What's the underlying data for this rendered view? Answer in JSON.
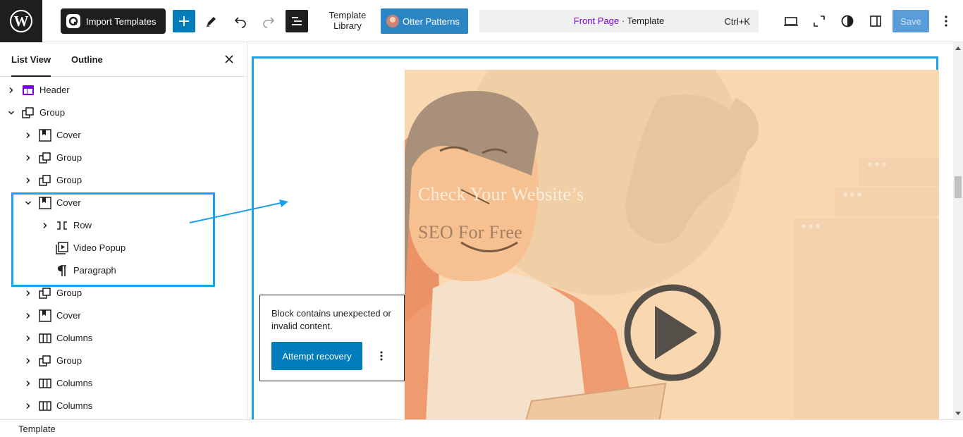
{
  "topbar": {
    "import_label": "Import Templates",
    "template_library_line1": "Template",
    "template_library_line2": "Library",
    "otter_label": "Otter Patterns",
    "command_page": "Front Page",
    "command_sep": " · ",
    "command_type": "Template",
    "command_shortcut": "Ctrl+K",
    "save_label": "Save",
    "icons": [
      "wordpress-icon",
      "plus-icon",
      "pen-icon",
      "undo-icon",
      "redo-icon",
      "list-view-icon",
      "desktop-icon",
      "fullscreen-icon",
      "contrast-icon",
      "sidebar-icon",
      "more-vertical-icon"
    ]
  },
  "sidebar": {
    "tabs": [
      {
        "label": "List View",
        "active": true
      },
      {
        "label": "Outline",
        "active": false
      }
    ],
    "tree": [
      {
        "label": "Header",
        "level": 0,
        "expanded": false,
        "icon": "template-part-icon"
      },
      {
        "label": "Group",
        "level": 0,
        "expanded": true,
        "icon": "group-icon"
      },
      {
        "label": "Cover",
        "level": 1,
        "expanded": false,
        "icon": "cover-icon"
      },
      {
        "label": "Group",
        "level": 1,
        "expanded": false,
        "icon": "group-icon"
      },
      {
        "label": "Group",
        "level": 1,
        "expanded": false,
        "icon": "group-icon"
      },
      {
        "label": "Cover",
        "level": 1,
        "expanded": true,
        "icon": "cover-icon"
      },
      {
        "label": "Row",
        "level": 2,
        "expanded": false,
        "icon": "row-icon"
      },
      {
        "label": "Video Popup",
        "level": 2,
        "expanded": null,
        "icon": "video-popup-icon"
      },
      {
        "label": "Paragraph",
        "level": 2,
        "expanded": null,
        "icon": "paragraph-icon"
      },
      {
        "label": "Group",
        "level": 1,
        "expanded": false,
        "icon": "group-icon"
      },
      {
        "label": "Cover",
        "level": 1,
        "expanded": false,
        "icon": "cover-icon"
      },
      {
        "label": "Columns",
        "level": 1,
        "expanded": false,
        "icon": "columns-icon"
      },
      {
        "label": "Group",
        "level": 1,
        "expanded": false,
        "icon": "group-icon"
      },
      {
        "label": "Columns",
        "level": 1,
        "expanded": false,
        "icon": "columns-icon"
      },
      {
        "label": "Columns",
        "level": 1,
        "expanded": false,
        "icon": "columns-icon"
      }
    ]
  },
  "canvas": {
    "hero_line1": "Check Your Website’s",
    "hero_line2": "SEO For Free",
    "warning_text": "Block contains unexpected or invalid content.",
    "recover_label": "Attempt recovery"
  },
  "footer": {
    "breadcrumb": "Template"
  },
  "colors": {
    "accent": "#007cba",
    "highlight": "#1ba1e9",
    "cover_bg": "#f9d7b1",
    "purple": "#7a00df"
  }
}
